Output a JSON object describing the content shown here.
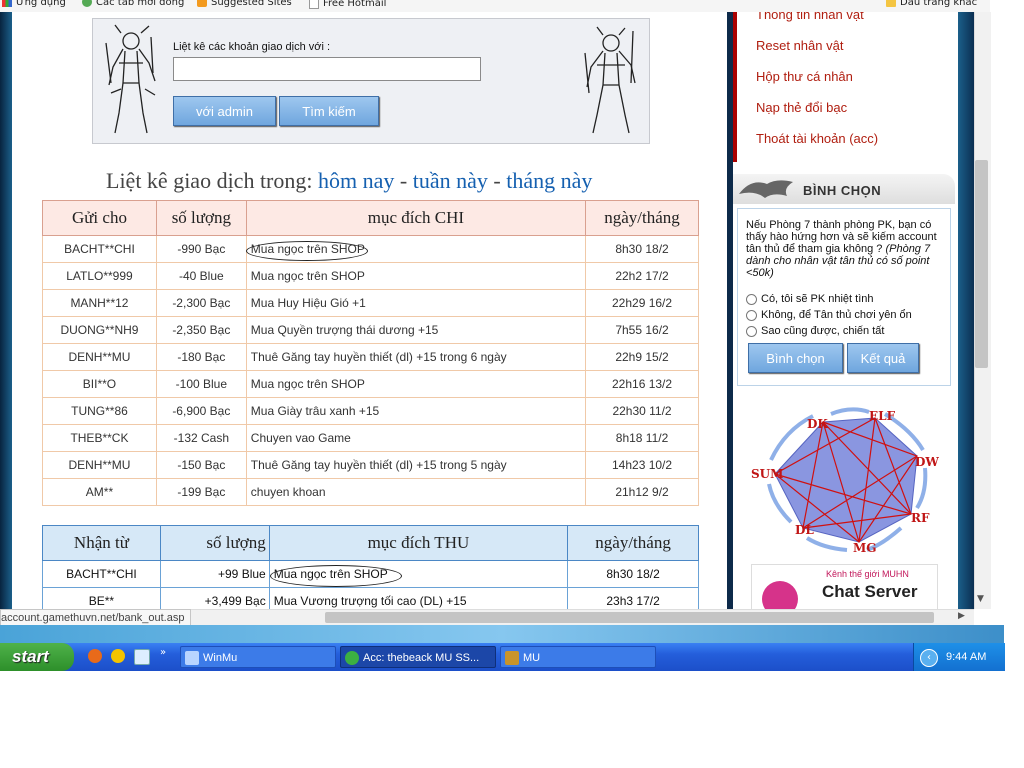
{
  "bookmarks": {
    "items": [
      {
        "label": "Ứng dụng"
      },
      {
        "label": "Các tab mới đóng"
      },
      {
        "label": "Suggested Sites"
      },
      {
        "label": "Free Hotmail"
      },
      {
        "label": "Dấu trang khác"
      }
    ]
  },
  "search": {
    "label": "Liệt kê các khoản giao dịch với :",
    "value": "",
    "admin_button": "với admin",
    "search_button": "Tìm kiếm"
  },
  "heading": {
    "prefix": "Liệt kê giao dịch trong:",
    "today": "hôm nay",
    "sep": "-",
    "week": "tuần này",
    "month": "tháng này"
  },
  "chi_table": {
    "headers": [
      "Gửi cho",
      "số lượng",
      "mục đích CHI",
      "ngày/tháng"
    ],
    "rows": [
      {
        "name": "BACHT**CHI",
        "amount": "-990 Bạc",
        "purpose": "Mua ngọc trên SHOP",
        "date": "8h30 18/2"
      },
      {
        "name": "LATLO**999",
        "amount": "-40 Blue",
        "purpose": "Mua ngọc trên SHOP",
        "date": "22h2 17/2"
      },
      {
        "name": "MANH**12",
        "amount": "-2,300 Bạc",
        "purpose": "Mua Huy Hiệu Gió +1",
        "date": "22h29 16/2"
      },
      {
        "name": "DUONG**NH9",
        "amount": "-2,350 Bạc",
        "purpose": "Mua Quyền trượng thái dương +15",
        "date": "7h55 16/2"
      },
      {
        "name": "DENH**MU",
        "amount": "-180 Bạc",
        "purpose": "Thuê Găng tay huyền thiết (dl) +15 trong 6 ngày",
        "date": "22h9 15/2"
      },
      {
        "name": "BII**O",
        "amount": "-100 Blue",
        "purpose": "Mua ngọc trên SHOP",
        "date": "22h16 13/2"
      },
      {
        "name": "TUNG**86",
        "amount": "-6,900 Bạc",
        "purpose": "Mua Giày trâu xanh +15",
        "date": "22h30 11/2"
      },
      {
        "name": "THEB**CK",
        "amount": "-132 Cash",
        "purpose": "Chuyen vao Game",
        "date": "8h18 11/2"
      },
      {
        "name": "DENH**MU",
        "amount": "-150 Bạc",
        "purpose": "Thuê Găng tay huyền thiết (dl) +15 trong 5 ngày",
        "date": "14h23 10/2"
      },
      {
        "name": "AM**",
        "amount": "-199 Bạc",
        "purpose": "chuyen khoan",
        "date": "21h12 9/2"
      }
    ]
  },
  "thu_table": {
    "headers": [
      "Nhận từ",
      "số lượng",
      "mục đích THU",
      "ngày/tháng"
    ],
    "rows": [
      {
        "name": "BACHT**CHI",
        "amount": "+99 Blue",
        "purpose": "Mua ngọc trên SHOP",
        "date": "8h30 18/2"
      },
      {
        "name": "BE**",
        "amount": "+3,499 Bạc",
        "purpose": "Mua Vương trượng tối cao (DL) +15",
        "date": "23h3 17/2"
      }
    ]
  },
  "menu": {
    "items": [
      {
        "label": "Thông tin nhân vật"
      },
      {
        "label": "Reset nhân vật"
      },
      {
        "label": "Hộp thư cá nhân"
      },
      {
        "label": "Nạp thẻ đổi bạc"
      },
      {
        "label": "Thoát tài khoản (acc)"
      }
    ]
  },
  "poll": {
    "title": "BÌNH CHỌN",
    "question": "Nếu Phòng 7 thành phòng PK, bạn có thấy hào hứng hơn và sẽ kiếm account tân thủ để tham gia không ?",
    "note": "(Phòng 7 dành cho nhân vật tân thủ có số point <50k)",
    "options": [
      {
        "label": "Có, tôi sẽ PK nhiệt tình"
      },
      {
        "label": "Không, để Tân thủ chơi yên ổn"
      },
      {
        "label": "Sao cũng được, chiến tất"
      }
    ],
    "vote_button": "Bình chọn",
    "result_button": "Kết quả"
  },
  "diagram": {
    "labels": [
      "DK",
      "ELF",
      "DW",
      "RF",
      "MG",
      "DL",
      "SUM"
    ]
  },
  "chat_banner": {
    "tagline": "Kênh thế giới MUHN",
    "title": "Chat Server"
  },
  "status_url": "account.gamethuvn.net/bank_out.asp",
  "taskbar": {
    "start": "start",
    "windows": [
      {
        "label": "WinMu"
      },
      {
        "label": "Acc: thebeack MU SS..."
      },
      {
        "label": "MU"
      }
    ],
    "clock": "9:44 AM"
  },
  "colors": {
    "link_blue": "#1e6ec8",
    "menu_red": "#b01e10",
    "chi_header_bg": "#fde9e4",
    "thu_header_bg": "#d6e8f7",
    "button_blue": "#6fa6de",
    "taskbar_blue": "#245edb",
    "start_green": "#2d8f2a"
  }
}
